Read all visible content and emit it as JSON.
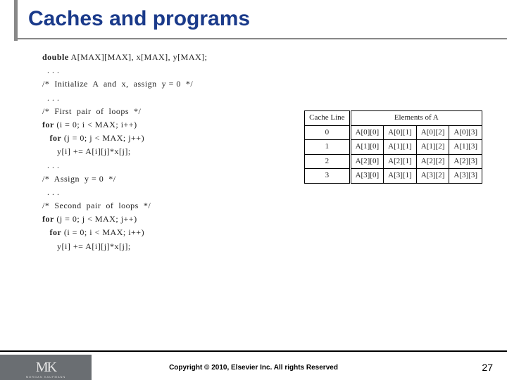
{
  "title": "Caches and programs",
  "code": {
    "decl_kw": "double",
    "decl_rest": " A[MAX][MAX], x[MAX], y[MAX];",
    "dots": "  . . .",
    "c_init": "/*  Initialize  A  and  x,  assign  y = 0  */",
    "c_first": "/*  First  pair  of  loops  */",
    "for_kw": "for",
    "for1a": " (i = 0; i < MAX; i++)",
    "for1b": " (j = 0; j < MAX; j++)",
    "body1": "      y[i] += A[i][j]*x[j];",
    "c_assign": "/*  Assign  y = 0  */",
    "c_second": "/*  Second  pair  of  loops  */",
    "for2a": " (j = 0; j < MAX; j++)",
    "for2b": " (i = 0; i < MAX; i++)",
    "body2": "      y[i] += A[i][j]*x[j];"
  },
  "table": {
    "h1": "Cache Line",
    "h2": "Elements of A",
    "rows": [
      {
        "line": "0",
        "c": [
          "A[0][0]",
          "A[0][1]",
          "A[0][2]",
          "A[0][3]"
        ]
      },
      {
        "line": "1",
        "c": [
          "A[1][0]",
          "A[1][1]",
          "A[1][2]",
          "A[1][3]"
        ]
      },
      {
        "line": "2",
        "c": [
          "A[2][0]",
          "A[2][1]",
          "A[2][2]",
          "A[2][3]"
        ]
      },
      {
        "line": "3",
        "c": [
          "A[3][0]",
          "A[3][1]",
          "A[3][2]",
          "A[3][3]"
        ]
      }
    ]
  },
  "footer": {
    "logo": "MK",
    "logo_sub": "MORGAN KAUFMANN",
    "copyright": "Copyright © 2010, Elsevier Inc. All rights Reserved",
    "page": "27"
  }
}
